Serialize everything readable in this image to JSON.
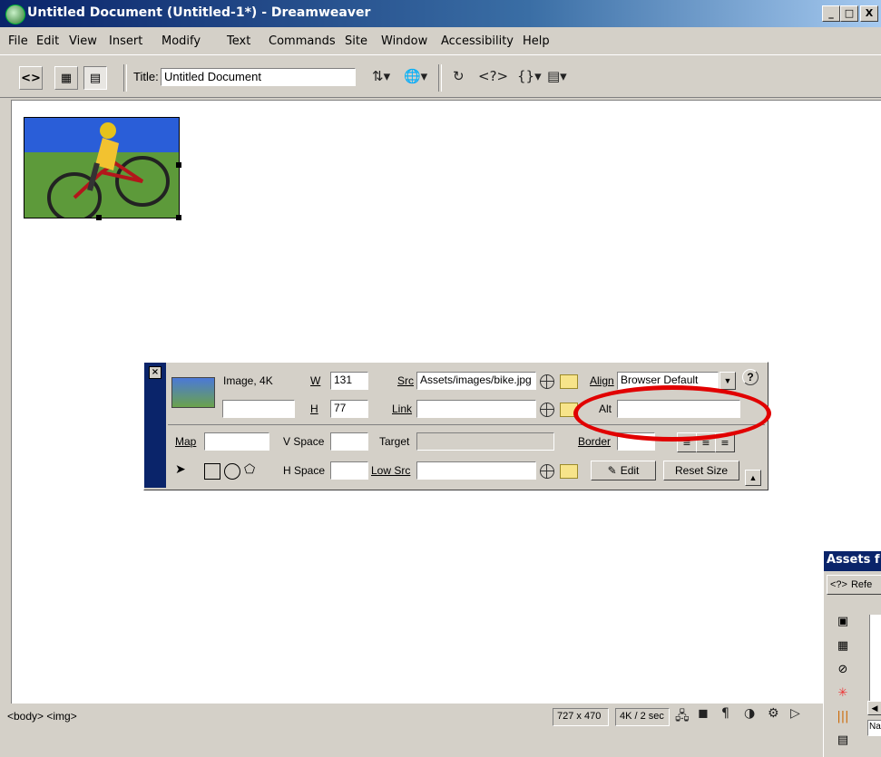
{
  "window": {
    "title": "Untitled Document (Untitled-1*) - Dreamweaver",
    "minimize": "_",
    "maximize": "□",
    "close": "X"
  },
  "menu": [
    "File",
    "Edit",
    "View",
    "Insert",
    "Modify",
    "Text",
    "Commands",
    "Site",
    "Window",
    "Accessibility",
    "Help"
  ],
  "toolbar": {
    "title_label": "Title:",
    "title_value": "Untitled Document",
    "icons": [
      "code-view-icon",
      "split-view-icon",
      "design-view-icon",
      "file-management-icon",
      "preview-browser-icon",
      "refresh-icon",
      "reference-icon",
      "code-navigation-icon",
      "view-options-icon"
    ]
  },
  "property_inspector": {
    "type_label": "Image, 4K",
    "name_value": "",
    "w_label": "W",
    "w_value": "131",
    "h_label": "H",
    "h_value": "77",
    "src_label": "Src",
    "src_value": "Assets/images/bike.jpg",
    "link_label": "Link",
    "link_value": "",
    "align_label": "Align",
    "align_value": "Browser Default",
    "alt_label": "Alt",
    "alt_value": "",
    "map_label": "Map",
    "map_value": "",
    "vspace_label": "V Space",
    "vspace_value": "",
    "hspace_label": "H Space",
    "hspace_value": "",
    "target_label": "Target",
    "target_value": "",
    "border_label": "Border",
    "border_value": "",
    "lowsrc_label": "Low Src",
    "lowsrc_value": "",
    "edit_button": "Edit",
    "reset_button": "Reset Size",
    "help": "?"
  },
  "status": {
    "tags": "<body> <img>",
    "size": "727 x 470",
    "download": "4K / 2 sec"
  },
  "assets_panel": {
    "title": "Assets f",
    "reference_tab": "Refe",
    "name_col": "Na"
  },
  "colors": {
    "highlight": "#e10000",
    "titlebar": "#0a246a"
  }
}
